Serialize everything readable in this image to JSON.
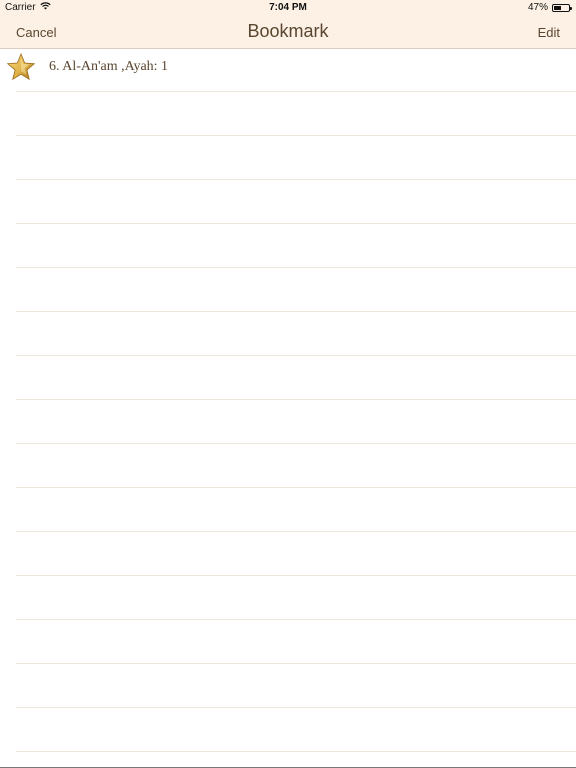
{
  "status_bar": {
    "carrier": "Carrier",
    "time": "7:04 PM",
    "battery": "47%",
    "battery_level": 0.47
  },
  "nav": {
    "cancel_label": "Cancel",
    "title": "Bookmark",
    "edit_label": "Edit"
  },
  "bookmarks": [
    {
      "text": "6. Al-An'am ,Ayah: 1",
      "icon": "star-icon"
    }
  ],
  "colors": {
    "header_bg": "#fcf1e4",
    "text": "#5a4630",
    "star": "#e0b347"
  }
}
